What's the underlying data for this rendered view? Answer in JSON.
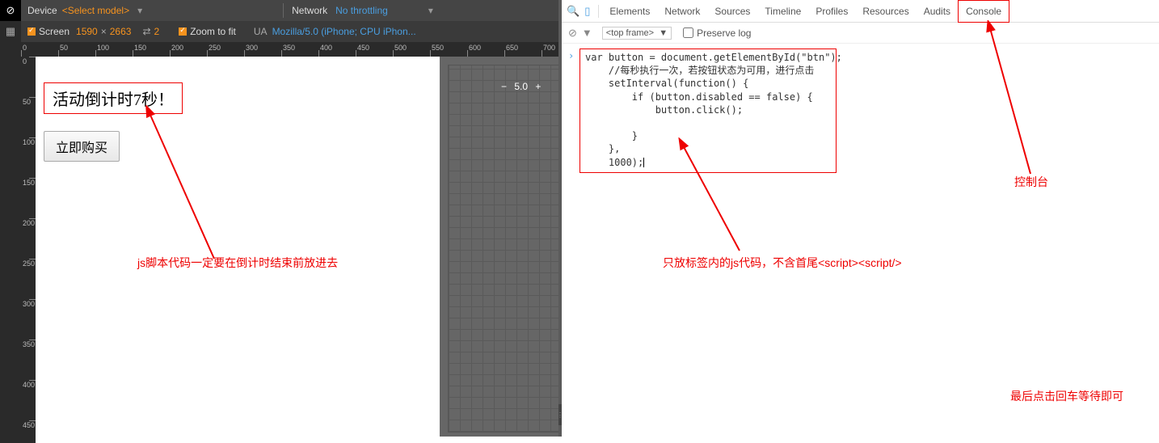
{
  "toolbar": {
    "device_label": "Device",
    "device_value": "<Select model>",
    "network_label": "Network",
    "network_value": "No throttling",
    "screen_label": "Screen",
    "screen_w": "1590",
    "screen_h": "2663",
    "dpr_icon_value": "2",
    "zoom_label": "Zoom to fit",
    "ua_label": "UA",
    "ua_value": "Mozilla/5.0 (iPhone; CPU iPhon..."
  },
  "ruler_h": [
    "0",
    "50",
    "100",
    "150",
    "200",
    "250",
    "300",
    "350",
    "400",
    "450",
    "500",
    "550",
    "600",
    "650",
    "700"
  ],
  "ruler_v": [
    "0",
    "50",
    "100",
    "150",
    "200",
    "250",
    "300",
    "350",
    "400",
    "450"
  ],
  "viewport": {
    "countdown_text": "活动倒计时7秒！",
    "buy_button_label": "立即购买"
  },
  "zoom": {
    "minus": "−",
    "value": "5.0",
    "plus": "+"
  },
  "devtools_tabs": [
    "Elements",
    "Network",
    "Sources",
    "Timeline",
    "Profiles",
    "Resources",
    "Audits",
    "Console"
  ],
  "console": {
    "frame": "<top frame>",
    "preserve_log": "Preserve log",
    "code": "var button = document.getElementById(\"btn\");\n    //每秒执行一次，若按钮状态为可用，进行点击\n    setInterval(function() {\n        if (button.disabled == false) {\n            button.click();\n\n        }\n    },\n    1000);"
  },
  "annotations": {
    "left_note": "js脚本代码一定要在倒计时结束前放进去",
    "mid_note": "只放标签内的js代码，不含首尾<script><script/>",
    "right_note": "控制台",
    "bottom_note": "最后点击回车等待即可"
  }
}
